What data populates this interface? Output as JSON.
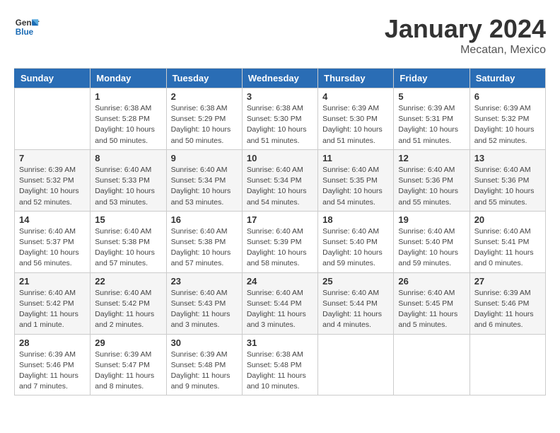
{
  "header": {
    "logo_line1": "General",
    "logo_line2": "Blue",
    "month": "January 2024",
    "location": "Mecatan, Mexico"
  },
  "weekdays": [
    "Sunday",
    "Monday",
    "Tuesday",
    "Wednesday",
    "Thursday",
    "Friday",
    "Saturday"
  ],
  "weeks": [
    [
      {
        "day": "",
        "info": ""
      },
      {
        "day": "1",
        "info": "Sunrise: 6:38 AM\nSunset: 5:28 PM\nDaylight: 10 hours\nand 50 minutes."
      },
      {
        "day": "2",
        "info": "Sunrise: 6:38 AM\nSunset: 5:29 PM\nDaylight: 10 hours\nand 50 minutes."
      },
      {
        "day": "3",
        "info": "Sunrise: 6:38 AM\nSunset: 5:30 PM\nDaylight: 10 hours\nand 51 minutes."
      },
      {
        "day": "4",
        "info": "Sunrise: 6:39 AM\nSunset: 5:30 PM\nDaylight: 10 hours\nand 51 minutes."
      },
      {
        "day": "5",
        "info": "Sunrise: 6:39 AM\nSunset: 5:31 PM\nDaylight: 10 hours\nand 51 minutes."
      },
      {
        "day": "6",
        "info": "Sunrise: 6:39 AM\nSunset: 5:32 PM\nDaylight: 10 hours\nand 52 minutes."
      }
    ],
    [
      {
        "day": "7",
        "info": "Sunrise: 6:39 AM\nSunset: 5:32 PM\nDaylight: 10 hours\nand 52 minutes."
      },
      {
        "day": "8",
        "info": "Sunrise: 6:40 AM\nSunset: 5:33 PM\nDaylight: 10 hours\nand 53 minutes."
      },
      {
        "day": "9",
        "info": "Sunrise: 6:40 AM\nSunset: 5:34 PM\nDaylight: 10 hours\nand 53 minutes."
      },
      {
        "day": "10",
        "info": "Sunrise: 6:40 AM\nSunset: 5:34 PM\nDaylight: 10 hours\nand 54 minutes."
      },
      {
        "day": "11",
        "info": "Sunrise: 6:40 AM\nSunset: 5:35 PM\nDaylight: 10 hours\nand 54 minutes."
      },
      {
        "day": "12",
        "info": "Sunrise: 6:40 AM\nSunset: 5:36 PM\nDaylight: 10 hours\nand 55 minutes."
      },
      {
        "day": "13",
        "info": "Sunrise: 6:40 AM\nSunset: 5:36 PM\nDaylight: 10 hours\nand 55 minutes."
      }
    ],
    [
      {
        "day": "14",
        "info": "Sunrise: 6:40 AM\nSunset: 5:37 PM\nDaylight: 10 hours\nand 56 minutes."
      },
      {
        "day": "15",
        "info": "Sunrise: 6:40 AM\nSunset: 5:38 PM\nDaylight: 10 hours\nand 57 minutes."
      },
      {
        "day": "16",
        "info": "Sunrise: 6:40 AM\nSunset: 5:38 PM\nDaylight: 10 hours\nand 57 minutes."
      },
      {
        "day": "17",
        "info": "Sunrise: 6:40 AM\nSunset: 5:39 PM\nDaylight: 10 hours\nand 58 minutes."
      },
      {
        "day": "18",
        "info": "Sunrise: 6:40 AM\nSunset: 5:40 PM\nDaylight: 10 hours\nand 59 minutes."
      },
      {
        "day": "19",
        "info": "Sunrise: 6:40 AM\nSunset: 5:40 PM\nDaylight: 10 hours\nand 59 minutes."
      },
      {
        "day": "20",
        "info": "Sunrise: 6:40 AM\nSunset: 5:41 PM\nDaylight: 11 hours\nand 0 minutes."
      }
    ],
    [
      {
        "day": "21",
        "info": "Sunrise: 6:40 AM\nSunset: 5:42 PM\nDaylight: 11 hours\nand 1 minute."
      },
      {
        "day": "22",
        "info": "Sunrise: 6:40 AM\nSunset: 5:42 PM\nDaylight: 11 hours\nand 2 minutes."
      },
      {
        "day": "23",
        "info": "Sunrise: 6:40 AM\nSunset: 5:43 PM\nDaylight: 11 hours\nand 3 minutes."
      },
      {
        "day": "24",
        "info": "Sunrise: 6:40 AM\nSunset: 5:44 PM\nDaylight: 11 hours\nand 3 minutes."
      },
      {
        "day": "25",
        "info": "Sunrise: 6:40 AM\nSunset: 5:44 PM\nDaylight: 11 hours\nand 4 minutes."
      },
      {
        "day": "26",
        "info": "Sunrise: 6:40 AM\nSunset: 5:45 PM\nDaylight: 11 hours\nand 5 minutes."
      },
      {
        "day": "27",
        "info": "Sunrise: 6:39 AM\nSunset: 5:46 PM\nDaylight: 11 hours\nand 6 minutes."
      }
    ],
    [
      {
        "day": "28",
        "info": "Sunrise: 6:39 AM\nSunset: 5:46 PM\nDaylight: 11 hours\nand 7 minutes."
      },
      {
        "day": "29",
        "info": "Sunrise: 6:39 AM\nSunset: 5:47 PM\nDaylight: 11 hours\nand 8 minutes."
      },
      {
        "day": "30",
        "info": "Sunrise: 6:39 AM\nSunset: 5:48 PM\nDaylight: 11 hours\nand 9 minutes."
      },
      {
        "day": "31",
        "info": "Sunrise: 6:38 AM\nSunset: 5:48 PM\nDaylight: 11 hours\nand 10 minutes."
      },
      {
        "day": "",
        "info": ""
      },
      {
        "day": "",
        "info": ""
      },
      {
        "day": "",
        "info": ""
      }
    ]
  ]
}
